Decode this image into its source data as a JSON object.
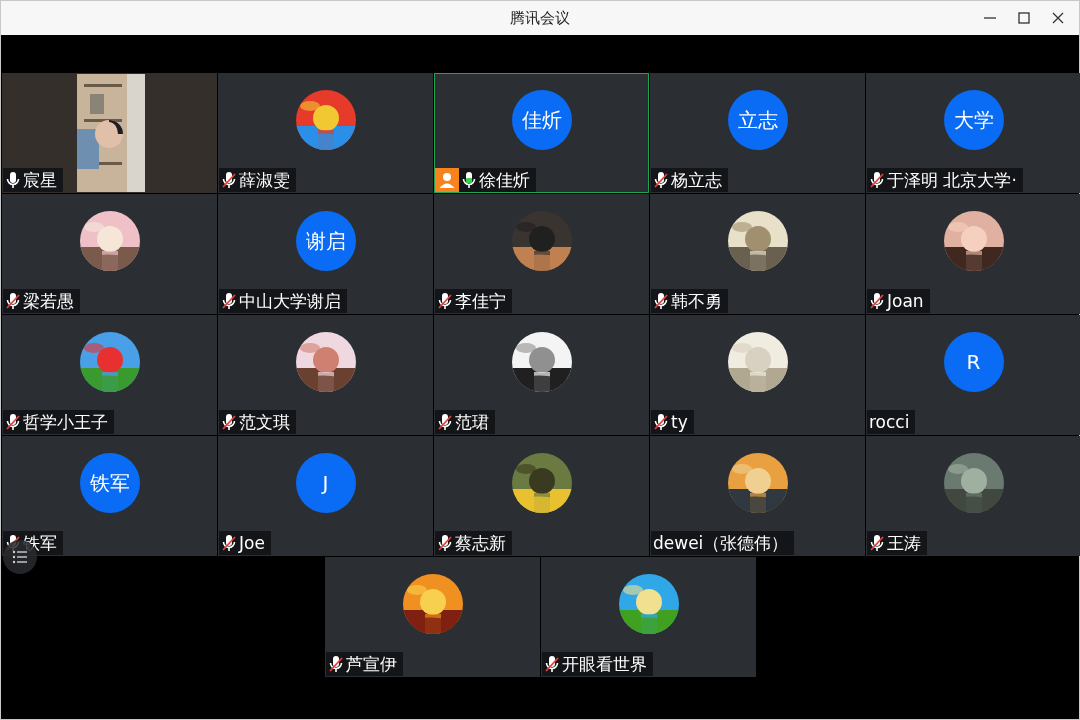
{
  "window": {
    "title": "腾讯会议"
  },
  "rows": [
    {
      "tiles": [
        {
          "name": "宸星",
          "mic": {
            "muted": false,
            "talking": false
          },
          "avatar": {
            "kind": "video"
          },
          "speaking": false,
          "host": false
        },
        {
          "name": "薛淑雯",
          "mic": {
            "muted": true,
            "talking": false
          },
          "speaking": false,
          "host": false
        },
        {
          "name": "徐佳炘",
          "mic": {
            "muted": false,
            "talking": true
          },
          "avatar": {
            "kind": "initials",
            "text": "佳炘"
          },
          "speaking": true,
          "host": true
        },
        {
          "name": "杨立志",
          "mic": {
            "muted": true,
            "talking": false
          },
          "avatar": {
            "kind": "initials",
            "text": "立志"
          },
          "speaking": false,
          "host": false
        },
        {
          "name": "于泽明 北京大学·",
          "mic": {
            "muted": true,
            "talking": false
          },
          "avatar": {
            "kind": "initials",
            "text": "大学"
          },
          "speaking": false,
          "host": false
        }
      ]
    },
    {
      "tiles": [
        {
          "name": "梁若愚",
          "mic": {
            "muted": true,
            "talking": false
          },
          "speaking": false,
          "host": false
        },
        {
          "name": "中山大学谢启",
          "mic": {
            "muted": true,
            "talking": false
          },
          "avatar": {
            "kind": "initials",
            "text": "谢启"
          },
          "speaking": false,
          "host": false
        },
        {
          "name": "李佳宁",
          "mic": {
            "muted": true,
            "talking": false
          },
          "speaking": false,
          "host": false
        },
        {
          "name": "韩不勇",
          "mic": {
            "muted": true,
            "talking": false
          },
          "speaking": false,
          "host": false
        },
        {
          "name": "Joan",
          "mic": {
            "muted": true,
            "talking": false
          },
          "speaking": false,
          "host": false
        }
      ]
    },
    {
      "tiles": [
        {
          "name": "哲学小王子",
          "mic": {
            "muted": true,
            "talking": false
          },
          "speaking": false,
          "host": false
        },
        {
          "name": "范文琪",
          "mic": {
            "muted": true,
            "talking": false
          },
          "speaking": false,
          "host": false
        },
        {
          "name": "范珺",
          "mic": {
            "muted": true,
            "talking": false
          },
          "speaking": false,
          "host": false
        },
        {
          "name": "ty",
          "mic": {
            "muted": true,
            "talking": false
          },
          "speaking": false,
          "host": false
        },
        {
          "name": "rocci",
          "avatar": {
            "kind": "initials",
            "text": "R"
          },
          "speaking": false,
          "host": false
        }
      ]
    },
    {
      "tiles": [
        {
          "name": "铁军",
          "mic": {
            "muted": true,
            "talking": false
          },
          "avatar": {
            "kind": "initials",
            "text": "铁军"
          },
          "speaking": false,
          "host": false
        },
        {
          "name": "Joe",
          "mic": {
            "muted": true,
            "talking": false
          },
          "avatar": {
            "kind": "initials",
            "text": "J"
          },
          "speaking": false,
          "host": false
        },
        {
          "name": "蔡志新",
          "mic": {
            "muted": true,
            "talking": false
          },
          "speaking": false,
          "host": false
        },
        {
          "name": "dewei（张德伟）",
          "speaking": false,
          "host": false
        },
        {
          "name": "王涛",
          "mic": {
            "muted": true,
            "talking": false
          },
          "speaking": false,
          "host": false
        }
      ]
    },
    {
      "tiles": [
        {
          "name": "芦宣伊",
          "mic": {
            "muted": true,
            "talking": false
          },
          "speaking": false,
          "host": false
        },
        {
          "name": "开眼看世界",
          "mic": {
            "muted": true,
            "talking": false
          },
          "speaking": false,
          "host": false
        }
      ]
    }
  ]
}
